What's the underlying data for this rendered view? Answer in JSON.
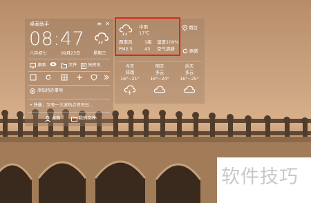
{
  "widget": {
    "title": "桌面助手",
    "menu_icon": "menu-icon",
    "close_icon": "close-icon",
    "time": "08:47",
    "weather_icon": "cloud-icon",
    "lunar_date": "八月初七",
    "solar_date": "09月23日",
    "weekday": "星期三",
    "nav": [
      {
        "icon": "monitor-icon",
        "label": "桌面"
      },
      {
        "icon": "eye-icon",
        "label": ""
      },
      {
        "icon": "folder-icon",
        "label": "文件"
      },
      {
        "icon": "document-icon",
        "label": "快资讯"
      }
    ],
    "tools": [
      "square-icon",
      "refresh-icon",
      "grid-icon",
      "plus-icon",
      "shield-icon",
      "more-icon"
    ],
    "todo_label": "添加待办事项",
    "ticker": "• 快叠，又有一大波热点资讯已...",
    "bottom": [
      {
        "icon": "person-icon",
        "label": "桌面"
      },
      {
        "icon": "folder-icon",
        "label": "我的文件"
      }
    ]
  },
  "weather": {
    "condition": "中雨",
    "temperature": "17℃",
    "wind_direction": "西南风",
    "wind_level": "1级",
    "humidity": "湿度100%",
    "pm_label": "PM2.5",
    "pm_value": "43",
    "air_quality": "空气清新",
    "city": "烟台",
    "refresh_label": "刷新",
    "forecast": [
      {
        "day": "今天",
        "condition": "阵雨",
        "range": "16°~21°",
        "icon": "rain-cloud-icon"
      },
      {
        "day": "明天",
        "condition": "多云",
        "range": "16°~24°",
        "icon": "cloud-icon"
      },
      {
        "day": "后天",
        "condition": "多云",
        "range": "16°~25°",
        "icon": "cloud-icon"
      }
    ]
  },
  "watermark": {
    "text": "软件技巧"
  },
  "colors": {
    "highlight": "#e4251b",
    "panel": "#96785f",
    "text": "#ffffff"
  }
}
